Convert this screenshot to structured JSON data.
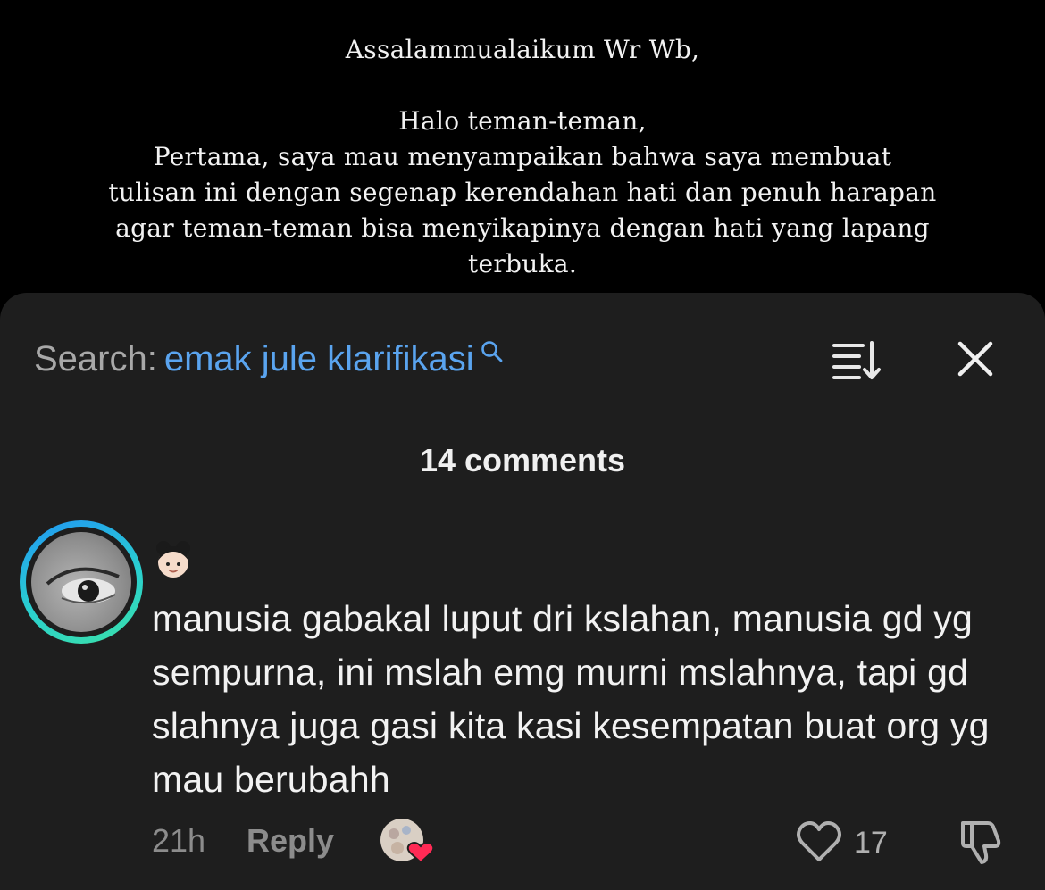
{
  "video": {
    "lines": [
      "Assalammualaikum Wr Wb,",
      "Halo teman-teman,",
      "Pertama, saya mau menyampaikan bahwa saya membuat",
      "tulisan ini dengan segenap kerendahan hati dan penuh harapan",
      "agar teman-teman bisa menyikapinya dengan hati yang lapang",
      "terbuka."
    ]
  },
  "panel": {
    "search_label": "Search:",
    "search_term": "emak jule klarifikasi",
    "sort_icon": "sort-icon",
    "close_icon": "close-icon",
    "comment_count": "14 comments"
  },
  "comment": {
    "username_emoji": "👧🏻",
    "text": "manusia gabakal luput dri kslahan, manusia gd yg sempurna, ini mslah emg murni mslahnya, tapi gd slahnya juga gasi kita kasi kesempatan buat org yg mau berubahh",
    "time": "21h",
    "reply_label": "Reply",
    "like_count": "17"
  },
  "colors": {
    "sheet_bg": "#1e1e1e",
    "search_term": "#5aa4ef",
    "muted": "#8c8c8c",
    "heart": "#ff2a55"
  }
}
